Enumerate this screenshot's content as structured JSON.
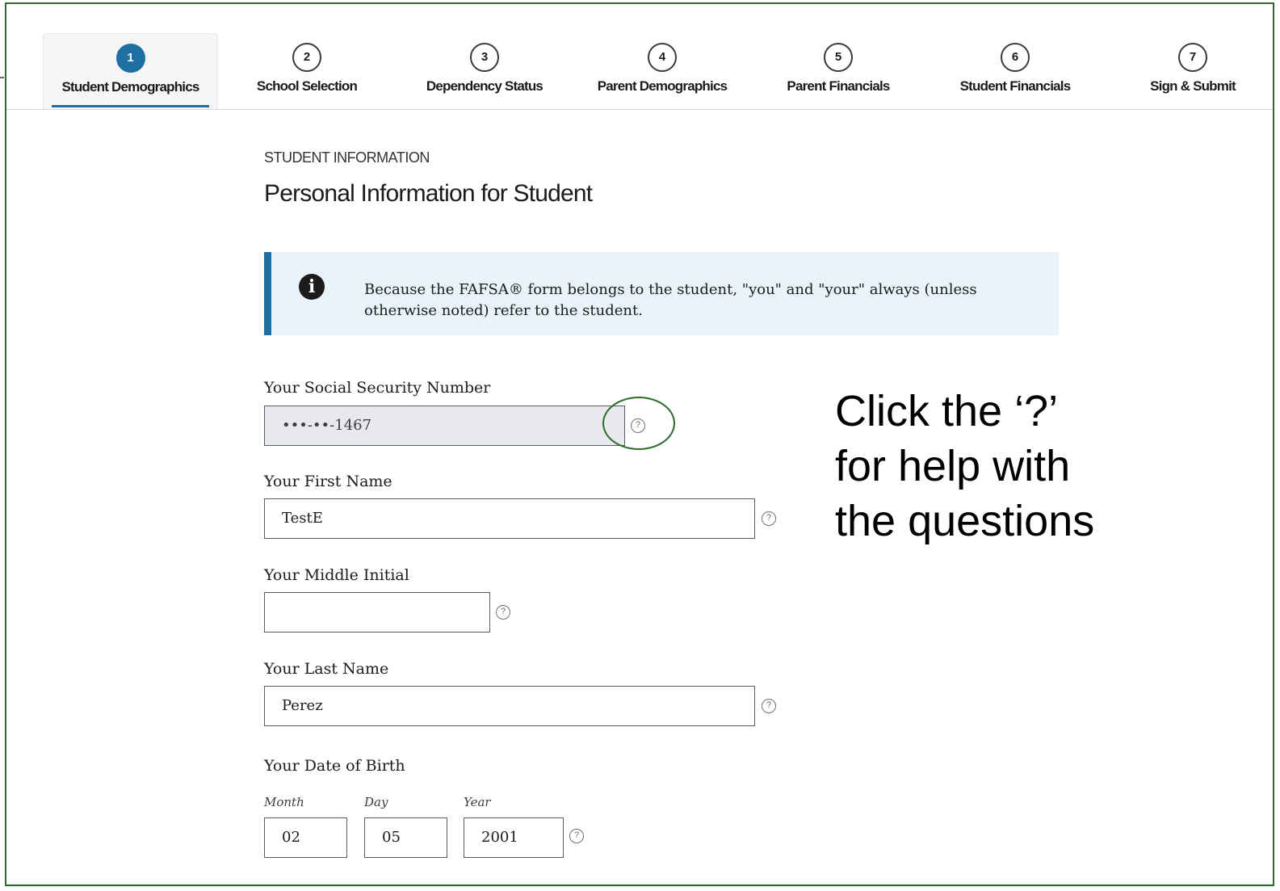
{
  "steps": [
    {
      "number": "1",
      "label": "Student Demographics"
    },
    {
      "number": "2",
      "label": "School Selection"
    },
    {
      "number": "3",
      "label": "Dependency Status"
    },
    {
      "number": "4",
      "label": "Parent Demographics"
    },
    {
      "number": "5",
      "label": "Parent Financials"
    },
    {
      "number": "6",
      "label": "Student Financials"
    },
    {
      "number": "7",
      "label": "Sign & Submit"
    }
  ],
  "active_step": "1",
  "section_kicker": "STUDENT INFORMATION",
  "page_title": "Personal Information for Student",
  "alert": {
    "icon": "info-icon",
    "text": "Because the FAFSA® form belongs to the student, \"you\" and \"your\" always (unless otherwise noted) refer to the student."
  },
  "fields": {
    "ssn": {
      "label": "Your Social Security Number",
      "value": "•••-••-1467"
    },
    "first_name": {
      "label": "Your First Name",
      "value": "TestE"
    },
    "middle_initial": {
      "label": "Your Middle Initial",
      "value": ""
    },
    "last_name": {
      "label": "Your Last Name",
      "value": "Perez"
    },
    "dob": {
      "label": "Your Date of Birth",
      "month_label": "Month",
      "month": "02",
      "day_label": "Day",
      "day": "05",
      "year_label": "Year",
      "year": "2001"
    }
  },
  "help_glyph": "?",
  "callout_text": "Click the ‘?’ for help with the questions",
  "colors": {
    "accent": "#1f6fa3",
    "alert_background": "#e8f3fa",
    "frame_border": "#2e6b2e"
  }
}
